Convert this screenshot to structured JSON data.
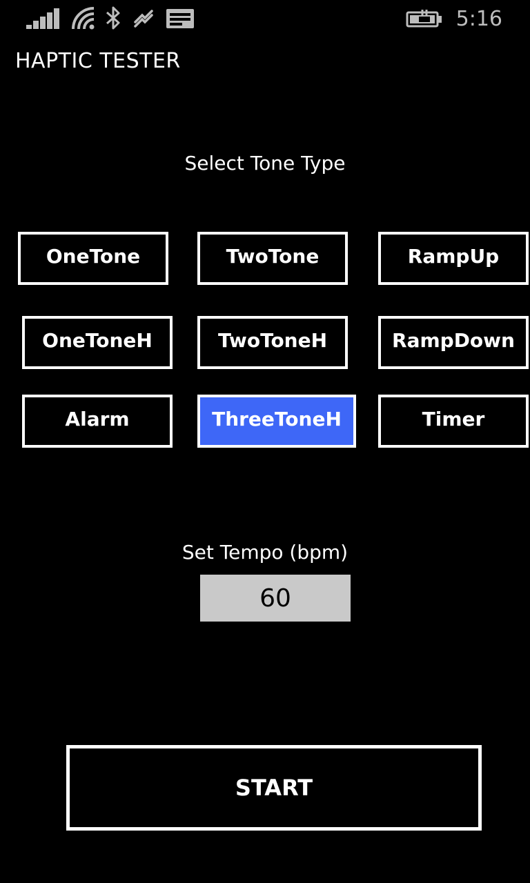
{
  "status_bar": {
    "time": "5:16",
    "icons": [
      "signal-strength-icon",
      "wifi-icon",
      "bluetooth-icon",
      "sync-icon",
      "notification-icon",
      "battery-charging-icon"
    ]
  },
  "app": {
    "title": "HAPTIC TESTER"
  },
  "tone_section": {
    "label": "Select Tone Type",
    "selected": "ThreeToneH",
    "selected_color": "#3e67f7",
    "buttons": [
      {
        "label": "OneTone"
      },
      {
        "label": "TwoTone"
      },
      {
        "label": "RampUp"
      },
      {
        "label": "OneToneH"
      },
      {
        "label": "TwoToneH"
      },
      {
        "label": "RampDown"
      },
      {
        "label": "Alarm"
      },
      {
        "label": "ThreeToneH"
      },
      {
        "label": "Timer"
      }
    ]
  },
  "tempo_section": {
    "label": "Set Tempo (bpm)",
    "value": "60"
  },
  "start_button": {
    "label": "START"
  }
}
